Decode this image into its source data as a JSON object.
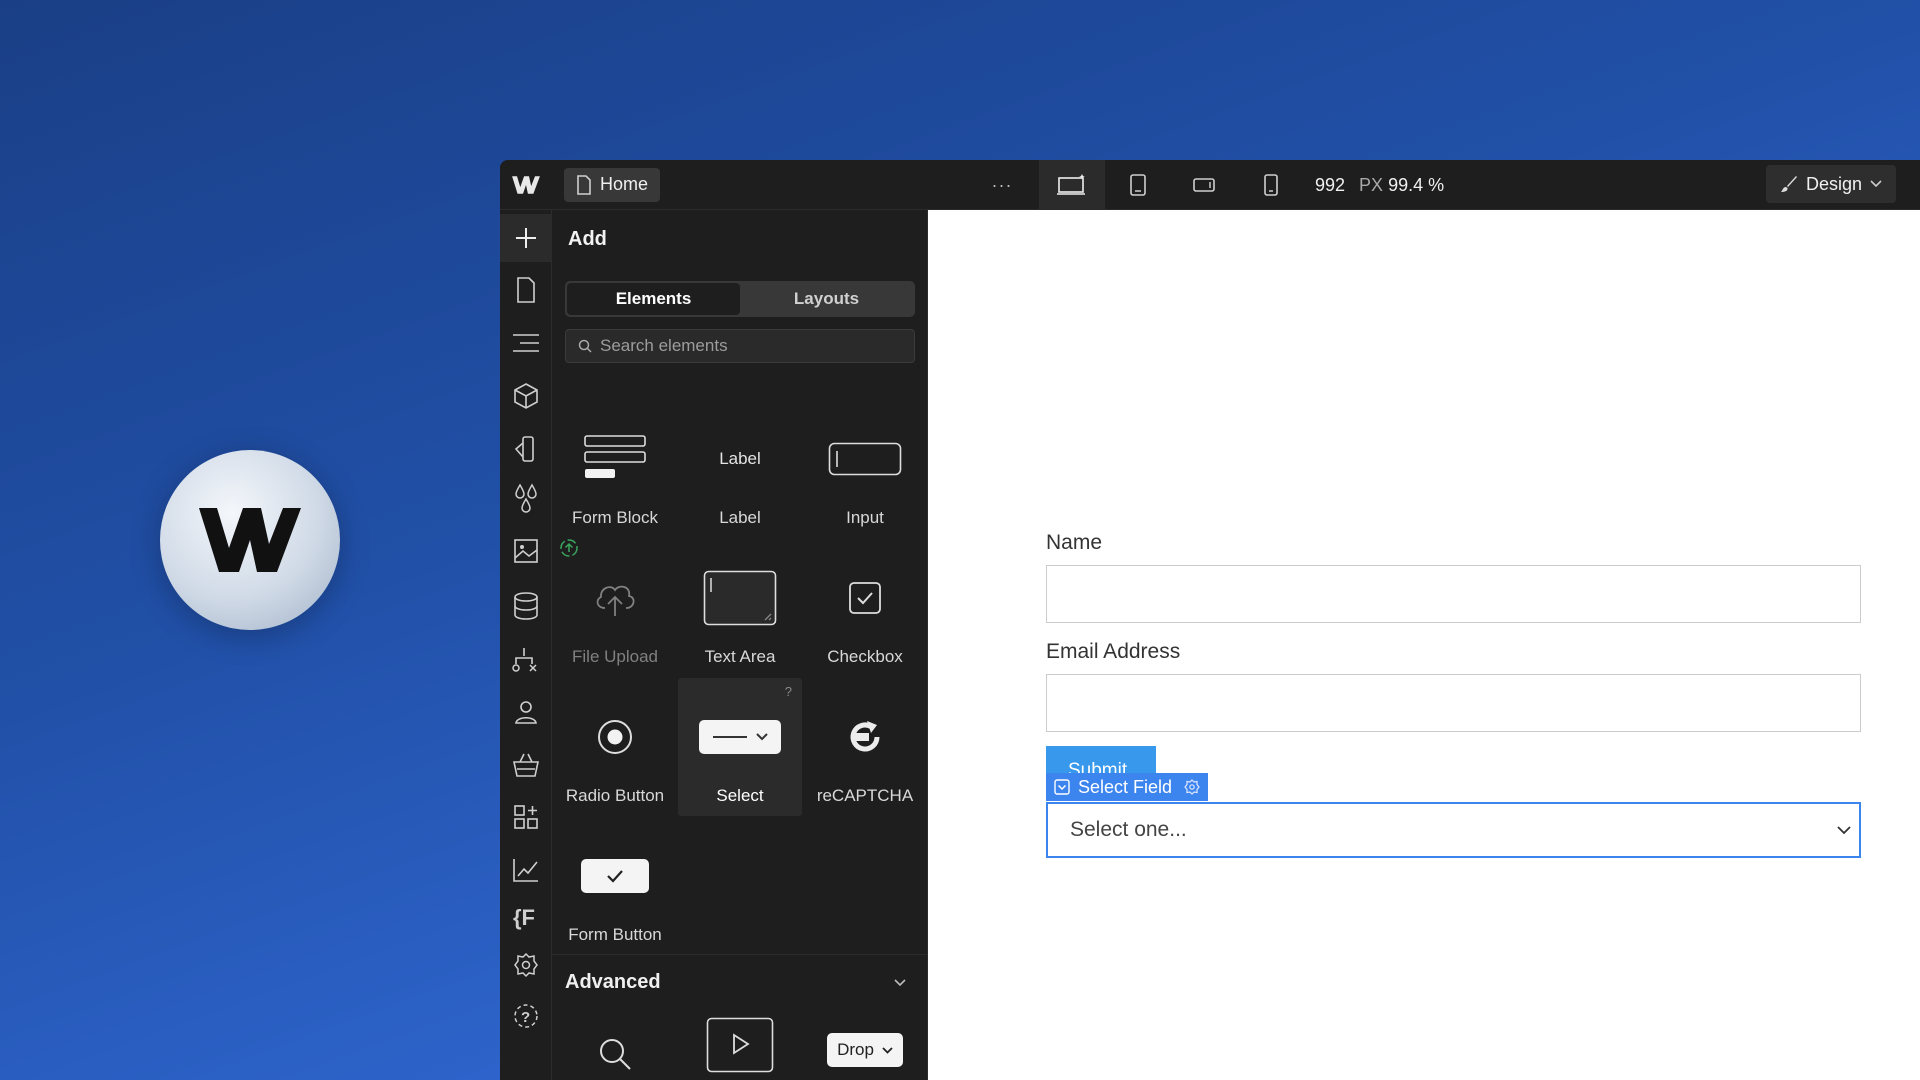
{
  "background_logo": {
    "icon": "webflow-logo-icon"
  },
  "topbar": {
    "page_name": "Home",
    "more": "···",
    "width_value": "992",
    "width_unit": "PX",
    "zoom": "99.4 %",
    "design_label": "Design"
  },
  "panel": {
    "title": "Add",
    "tabs": [
      "Elements",
      "Layouts"
    ],
    "active_tab": "Elements",
    "search_placeholder": "Search elements",
    "elements": [
      {
        "label": "Form Block",
        "icon": "form-block-icon"
      },
      {
        "label": "Label",
        "preview_text": "Label",
        "icon": "label-icon"
      },
      {
        "label": "Input",
        "icon": "input-icon"
      },
      {
        "label": "File Upload",
        "icon": "upload-icon",
        "locked": true
      },
      {
        "label": "Text Area",
        "icon": "textarea-icon"
      },
      {
        "label": "Checkbox",
        "icon": "checkbox-icon"
      },
      {
        "label": "Radio Button",
        "icon": "radio-icon"
      },
      {
        "label": "Select",
        "icon": "select-icon",
        "help": "?"
      },
      {
        "label": "reCAPTCHA",
        "icon": "recaptcha-icon"
      },
      {
        "label": "Form Button",
        "icon": "form-button-icon"
      }
    ],
    "advanced": {
      "title": "Advanced",
      "items_preview": [
        {
          "icon": "search-icon"
        },
        {
          "icon": "video-icon"
        },
        {
          "preview_text": "Drop",
          "icon": "dropdown-icon"
        }
      ]
    }
  },
  "canvas": {
    "fields": [
      {
        "label": "Name"
      },
      {
        "label": "Email Address"
      }
    ],
    "submit_label": "Submit",
    "selected_tag": "Select Field",
    "select_placeholder": "Select one..."
  },
  "colors": {
    "accent": "#3c84ee",
    "submit": "#3898ec",
    "panel_bg": "#1e1e1e"
  }
}
